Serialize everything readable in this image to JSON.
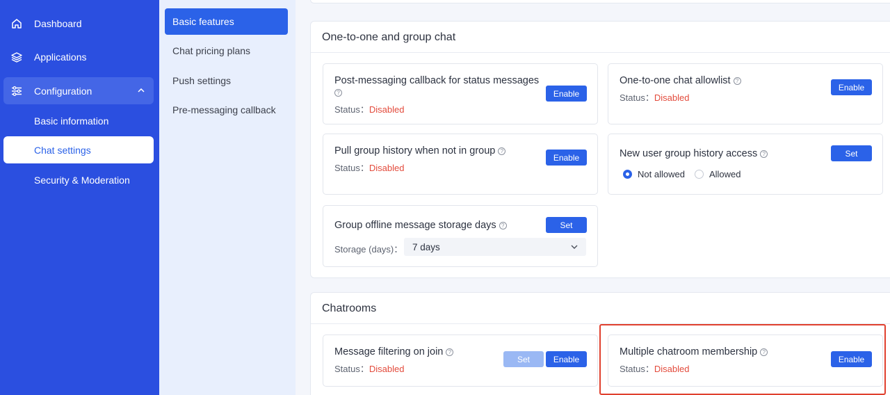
{
  "sidebar": {
    "items": [
      {
        "label": "Dashboard",
        "icon": "home-icon"
      },
      {
        "label": "Applications",
        "icon": "layers-icon"
      },
      {
        "label": "Configuration",
        "icon": "sliders-icon"
      }
    ],
    "sub_items": [
      {
        "label": "Basic information"
      },
      {
        "label": "Chat settings"
      },
      {
        "label": "Security & Moderation"
      }
    ]
  },
  "submenu": {
    "items": [
      {
        "label": "Basic features"
      },
      {
        "label": "Chat pricing plans"
      },
      {
        "label": "Push settings"
      },
      {
        "label": "Pre-messaging callback"
      }
    ]
  },
  "sections": {
    "one_to_one": {
      "title": "One-to-one and group chat",
      "cards": {
        "post_callback": {
          "title": "Post-messaging callback for status messages",
          "status_label": "Status：",
          "status_value": "Disabled",
          "button": "Enable"
        },
        "allowlist": {
          "title": "One-to-one chat allowlist",
          "status_label": "Status：",
          "status_value": "Disabled",
          "button": "Enable"
        },
        "pull_history": {
          "title": "Pull group history when not in group",
          "status_label": "Status：",
          "status_value": "Disabled",
          "button": "Enable"
        },
        "new_user_history": {
          "title": "New user group history access",
          "button": "Set",
          "option_not_allowed": "Not allowed",
          "option_allowed": "Allowed"
        },
        "offline_storage": {
          "title": "Group offline message storage days",
          "button": "Set",
          "storage_label": "Storage (days)：",
          "storage_value": "7 days"
        }
      }
    },
    "chatrooms": {
      "title": "Chatrooms",
      "cards": {
        "filtering": {
          "title": "Message filtering on join",
          "status_label": "Status：",
          "status_value": "Disabled",
          "set_button": "Set",
          "enable_button": "Enable"
        },
        "membership": {
          "title": "Multiple chatroom membership",
          "status_label": "Status：",
          "status_value": "Disabled",
          "button": "Enable"
        }
      }
    }
  },
  "colors": {
    "sidebar": "#2b4fe0",
    "accent": "#2b62e8",
    "disabled_status": "#e34b3c",
    "highlight": "#e0402e"
  }
}
